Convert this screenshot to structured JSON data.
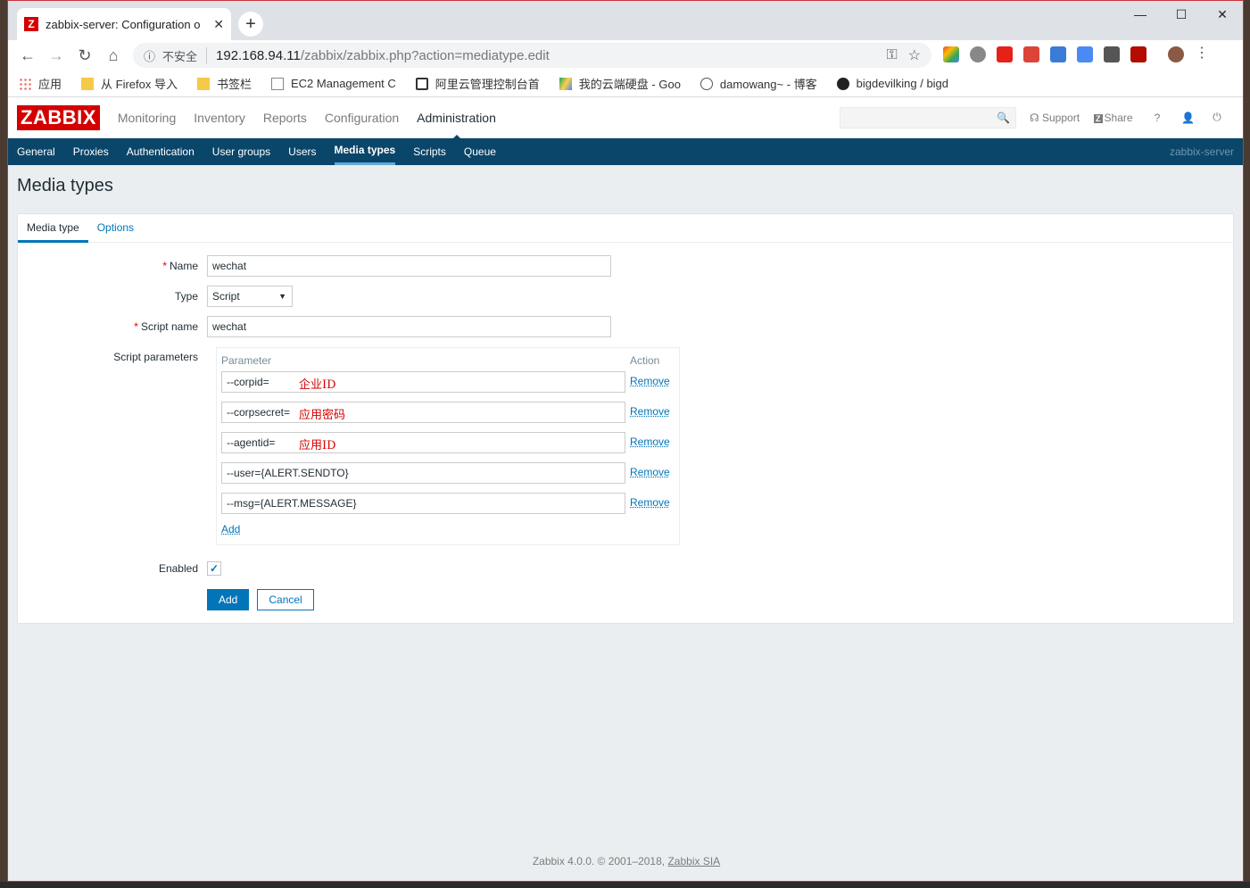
{
  "browser": {
    "tab_title": "zabbix-server: Configuration o",
    "tab_favicon": "Z",
    "address_insecure": "不安全",
    "address_host": "192.168.94.11",
    "address_path": "/zabbix/zabbix.php?action=mediatype.edit",
    "bookmarks": [
      {
        "label": "应用",
        "icon": "apps-grid-icon",
        "color": "#e8453c"
      },
      {
        "label": "从 Firefox 导入",
        "icon": "folder-icon",
        "color": "#f7c948"
      },
      {
        "label": "书签栏",
        "icon": "folder-icon",
        "color": "#f7c948"
      },
      {
        "label": "EC2 Management C",
        "icon": "page-icon",
        "color": "#888888"
      },
      {
        "label": "阿里云管理控制台首",
        "icon": "aliyun-icon",
        "color": "#333333"
      },
      {
        "label": "我的云端硬盘 - Goo",
        "icon": "drive-icon",
        "color": "#1fa463"
      },
      {
        "label": "damowang~ - 博客",
        "icon": "blog-icon",
        "color": "#555555"
      },
      {
        "label": "bigdevilking / bigd",
        "icon": "github-icon",
        "color": "#222222"
      }
    ]
  },
  "header": {
    "logo": "ZABBIX",
    "menu": [
      "Monitoring",
      "Inventory",
      "Reports",
      "Configuration",
      "Administration"
    ],
    "active_menu": "Administration",
    "support": "Support",
    "share": "Share",
    "help": "?"
  },
  "subnav": {
    "items": [
      "General",
      "Proxies",
      "Authentication",
      "User groups",
      "Users",
      "Media types",
      "Scripts",
      "Queue"
    ],
    "active": "Media types",
    "server_name": "zabbix-server"
  },
  "page": {
    "title": "Media types",
    "tabs": [
      "Media type",
      "Options"
    ]
  },
  "form": {
    "name_label": "Name",
    "name_value": "wechat",
    "type_label": "Type",
    "type_value": "Script",
    "script_name_label": "Script name",
    "script_name_value": "wechat",
    "script_params_label": "Script parameters",
    "param_header": "Parameter",
    "action_header": "Action",
    "params": [
      {
        "value": "--corpid=",
        "note": "企业ID"
      },
      {
        "value": "--corpsecret=",
        "note": "应用密码"
      },
      {
        "value": "--agentid=",
        "note": "应用ID"
      },
      {
        "value": "--user={ALERT.SENDTO}",
        "note": ""
      },
      {
        "value": "--msg={ALERT.MESSAGE}",
        "note": ""
      }
    ],
    "remove_label": "Remove",
    "add_param_label": "Add",
    "enabled_label": "Enabled",
    "enabled": true,
    "add_button": "Add",
    "cancel_button": "Cancel"
  },
  "footer": {
    "text": "Zabbix 4.0.0. © 2001–2018,",
    "company": "Zabbix SIA"
  },
  "colors": {
    "brand": "#d40000",
    "nav": "#0a466a",
    "link": "#0275b8"
  }
}
